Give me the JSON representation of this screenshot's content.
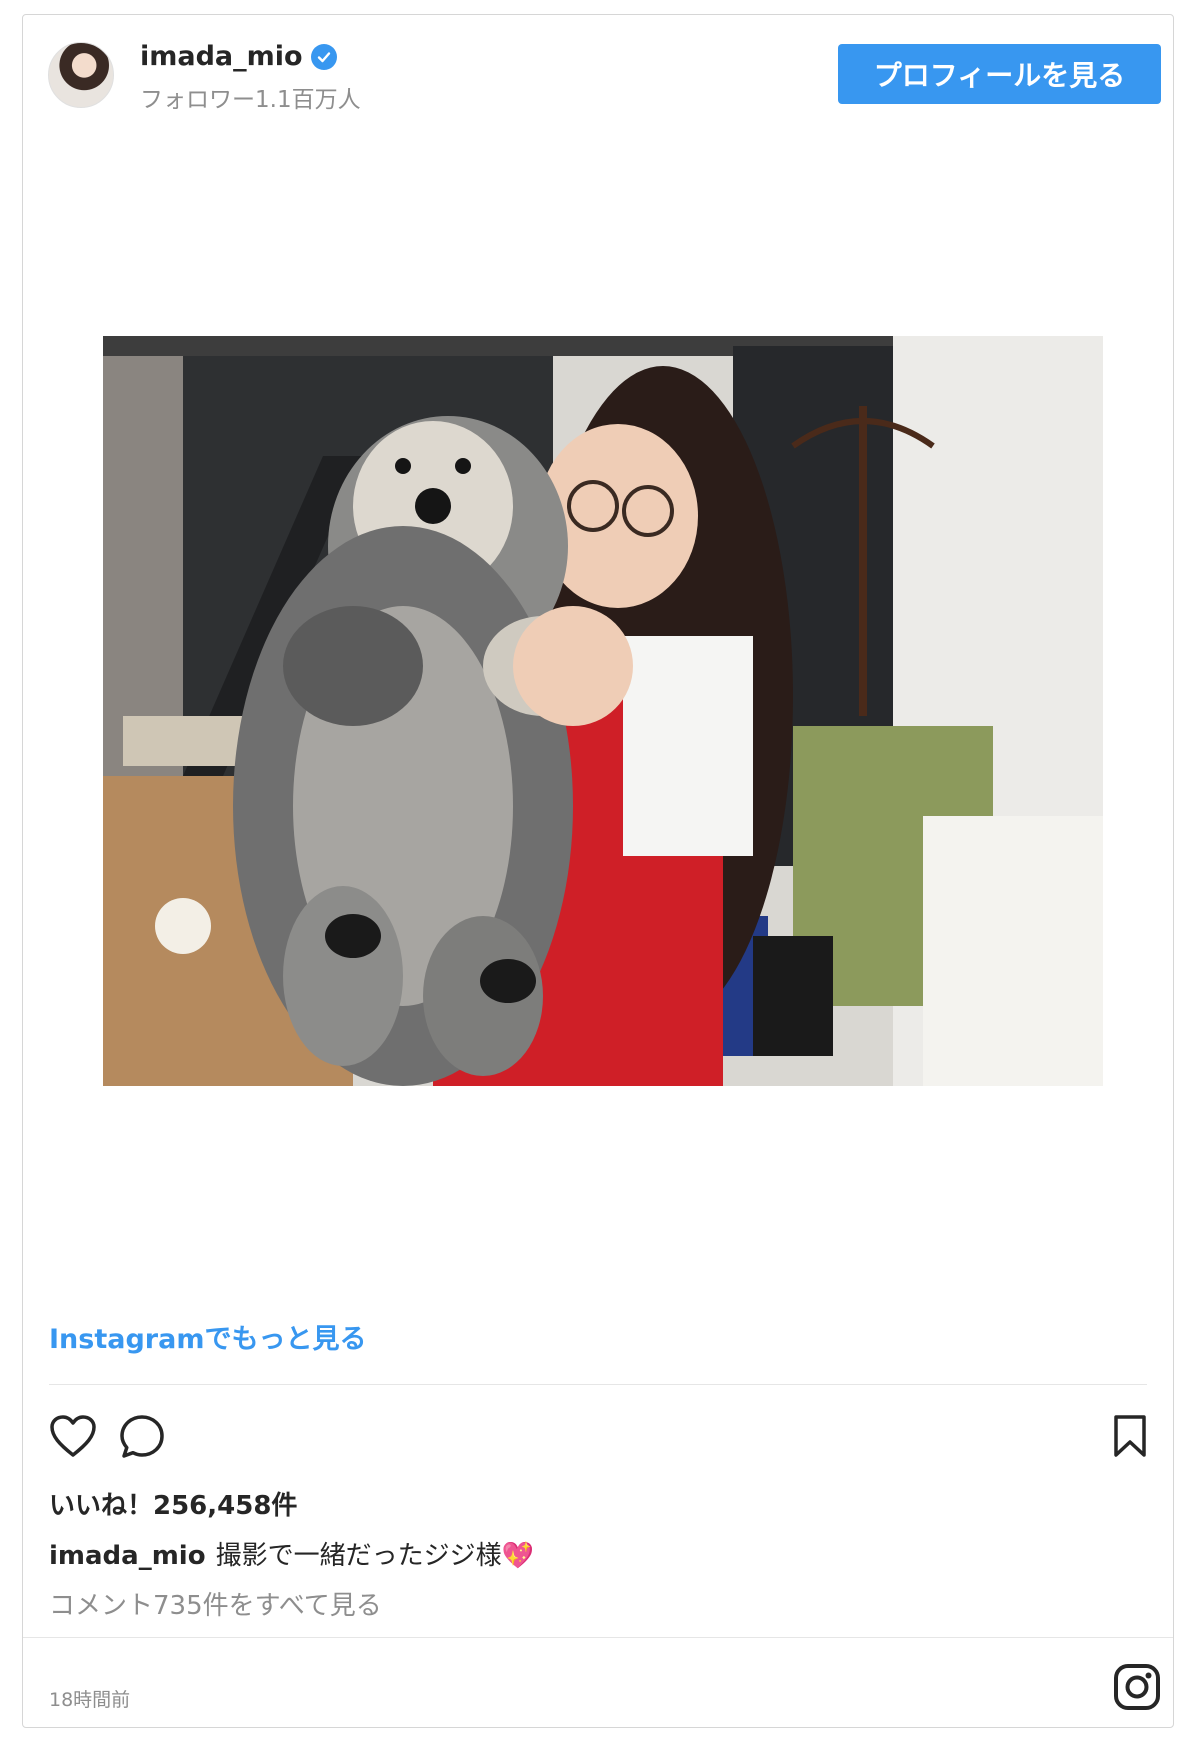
{
  "header": {
    "username": "imada_mio",
    "followers": "フォロワー1.1百万人",
    "profile_button": "プロフィールを見る"
  },
  "post": {
    "image_icon": "photo-woman-holding-dog",
    "more_link": "Instagramでもっと見る",
    "likes": "いいね！256,458件",
    "caption_user": "imada_mio",
    "caption_text": "撮影で一緒だったジジ様💖",
    "comments_link": "コメント735件をすべて見る",
    "timestamp": "18時間前"
  },
  "icons": {
    "like": "heart-icon",
    "comment": "comment-icon",
    "save": "bookmark-icon",
    "verified": "verified-badge-icon",
    "instagram": "instagram-logo-icon"
  },
  "colors": {
    "accent": "#3897f0",
    "text": "#262626",
    "muted": "#8e8e8e"
  }
}
